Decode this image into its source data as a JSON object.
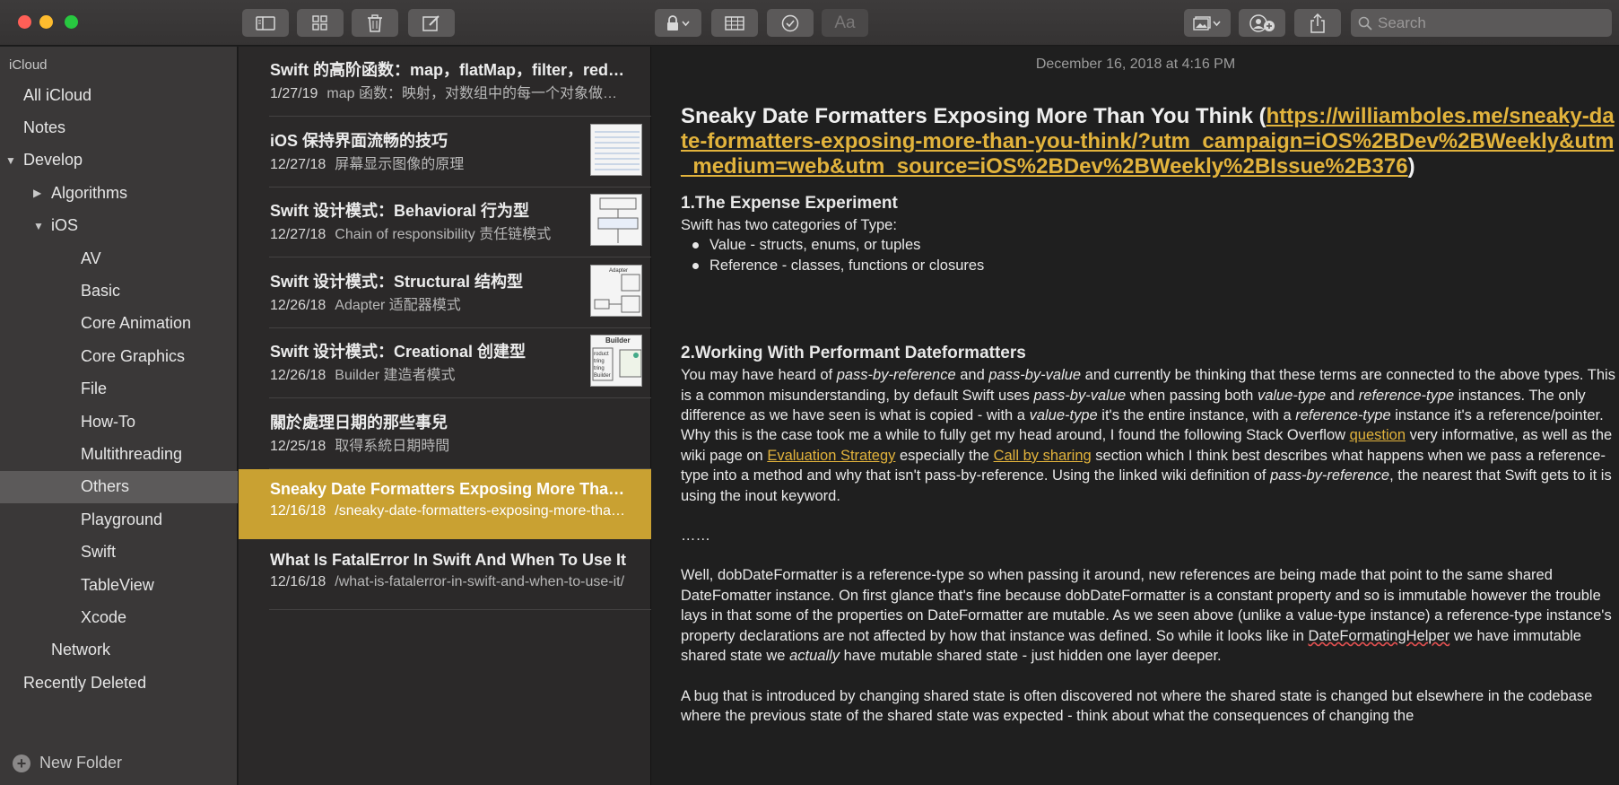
{
  "toolbar": {
    "search_placeholder": "Search",
    "font_button_label": "Aa"
  },
  "sidebar": {
    "account": "iCloud",
    "new_folder_label": "New Folder",
    "items": [
      {
        "label": "All iCloud",
        "level": 0,
        "disclosure": ""
      },
      {
        "label": "Notes",
        "level": 0,
        "disclosure": ""
      },
      {
        "label": "Develop",
        "level": 0,
        "disclosure": "▼"
      },
      {
        "label": "Algorithms",
        "level": 1,
        "disclosure": "▶"
      },
      {
        "label": "iOS",
        "level": 1,
        "disclosure": "▼"
      },
      {
        "label": "AV",
        "level": 2,
        "disclosure": ""
      },
      {
        "label": "Basic",
        "level": 2,
        "disclosure": ""
      },
      {
        "label": "Core Animation",
        "level": 2,
        "disclosure": ""
      },
      {
        "label": "Core Graphics",
        "level": 2,
        "disclosure": ""
      },
      {
        "label": "File",
        "level": 2,
        "disclosure": ""
      },
      {
        "label": "How-To",
        "level": 2,
        "disclosure": ""
      },
      {
        "label": "Multithreading",
        "level": 2,
        "disclosure": ""
      },
      {
        "label": "Others",
        "level": 2,
        "disclosure": "",
        "selected": true
      },
      {
        "label": "Playground",
        "level": 2,
        "disclosure": ""
      },
      {
        "label": "Swift",
        "level": 2,
        "disclosure": ""
      },
      {
        "label": "TableView",
        "level": 2,
        "disclosure": ""
      },
      {
        "label": "Xcode",
        "level": 2,
        "disclosure": ""
      },
      {
        "label": "Network",
        "level": 1,
        "disclosure": ""
      },
      {
        "label": "Recently Deleted",
        "level": 0,
        "disclosure": ""
      }
    ]
  },
  "notes": [
    {
      "title": "Swift 的高阶函数：map，flatMap，filter，reduce",
      "date": "1/27/19",
      "preview": "map 函数：映射，对数组中的每一个对象做一次运算",
      "thumb": ""
    },
    {
      "title": "iOS 保持界面流畅的技巧",
      "date": "12/27/18",
      "preview": "屏幕显示图像的原理",
      "thumb": "lines"
    },
    {
      "title": "Swift 设计模式：Behavioral 行为型",
      "date": "12/27/18",
      "preview": "Chain of responsibility 责任链模式",
      "thumb": "diagram"
    },
    {
      "title": "Swift 设计模式：Structural 结构型",
      "date": "12/26/18",
      "preview": "Adapter 适配器模式",
      "thumb": "adapter"
    },
    {
      "title": "Swift 设计模式：Creational 创建型",
      "date": "12/26/18",
      "preview": "Builder 建造者模式",
      "thumb": "builder"
    },
    {
      "title": "關於處理日期的那些事兒",
      "date": "12/25/18",
      "preview": "取得系統日期時間",
      "thumb": ""
    },
    {
      "title": "Sneaky Date Formatters Exposing More Than You Think",
      "date": "12/16/18",
      "preview": "/sneaky-date-formatters-exposing-more-than-you-think/",
      "thumb": "",
      "selected": true
    },
    {
      "title": "What Is FatalError In Swift And When To Use It",
      "date": "12/16/18",
      "preview": "/what-is-fatalerror-in-swift-and-when-to-use-it/",
      "thumb": ""
    }
  ],
  "thumb_text": {
    "adapter": "Adapter",
    "builder": "Builder",
    "builder_labels": [
      "roduct",
      "tring",
      "tring",
      "Builder"
    ]
  },
  "editor": {
    "date": "December 16, 2018 at 4:16 PM",
    "title_prefix": "Sneaky Date Formatters Exposing More Than You Think (",
    "title_link": "https://williamboles.me/sneaky-date-formatters-exposing-more-than-you-think/?utm_campaign=iOS%2BDev%2BWeekly&utm_medium=web&utm_source=iOS%2BDev%2BWeekly%2BIssue%2B376",
    "title_suffix": ")",
    "h2_1": "1.The Expense Experiment",
    "p1": "Swift has two categories of Type:",
    "bullets": [
      "Value - structs, enums, or tuples",
      "Reference - classes, functions or closures"
    ],
    "h2_2": "2.Working With Performant Dateformatters",
    "p2": {
      "a": "You may have heard of ",
      "b": "pass-by-reference",
      "c": " and ",
      "d": "pass-by-value",
      "e": " and currently be thinking that these terms are connected to the above types. This is a common misunderstanding, by default Swift uses ",
      "f": "pass-by-value",
      "g": " when passing both ",
      "h": "value-type",
      "i": " and ",
      "j": "reference-type",
      "k": " instances. The only difference as we have seen is what is copied - with a ",
      "l": "value-type",
      "m": " it's the entire instance, with a ",
      "n": "reference-type",
      "o": " instance it's a reference/pointer. Why this is the case took me a while to fully get my head around, I found the following Stack Overflow ",
      "link1": "question",
      "p": " very informative, as well as the wiki page on ",
      "link2": "Evaluation Strategy",
      "q": " especially the ",
      "link3": "Call by sharing",
      "r": " section which I think best describes what happens when we pass a reference-type into a method and why that isn't pass-by-reference. Using the linked wiki definition of ",
      "s": "pass-by-reference",
      "t": ", the nearest that Swift gets to it is using the inout keyword."
    },
    "ellipsis": "……",
    "p3": {
      "a": "Well, dobDateFormatter is a reference-type so when passing it around, new references are being made that point to the same shared DateFomatter instance. On first glance that's fine because dobDateFormatter is a constant property and so is immutable however the trouble lays in that some of the properties on DateFormatter are mutable. As we seen above (unlike a value-type instance) a reference-type instance's property declarations are not affected by how that instance was defined. So while it looks like in ",
      "b": "DateFormatingHelper",
      "c": " we have immutable shared state we ",
      "d": "actually",
      "e": " have mutable shared state - just hidden one layer deeper."
    },
    "p4": "A bug that is introduced by changing shared state is often discovered not where the shared state is changed but elsewhere in the codebase where the previous state of the shared state was expected - think about what the consequences of changing the"
  }
}
